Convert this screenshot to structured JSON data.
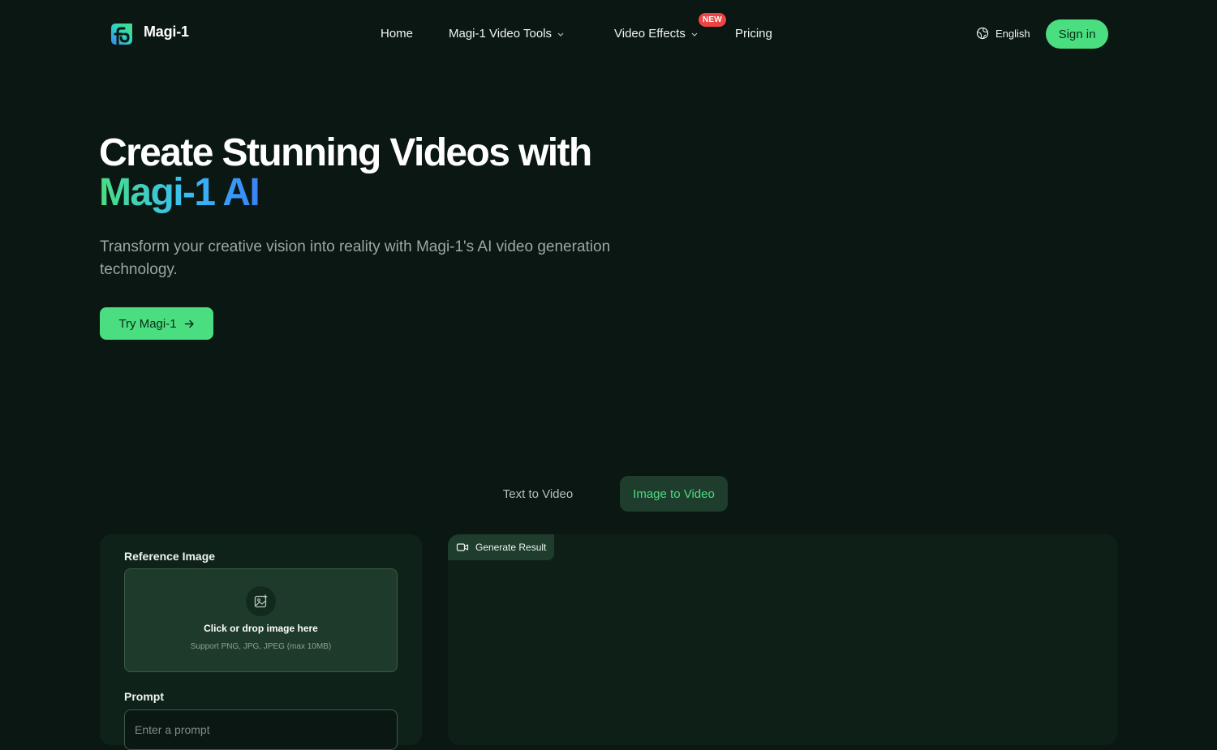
{
  "nav": {
    "brand": "Magi-1",
    "links": {
      "home": "Home",
      "video_tools": "Magi-1 Video Tools",
      "video_effects": "Video Effects",
      "pricing": "Pricing"
    },
    "new_badge": "NEW",
    "language": "English",
    "sign_in": "Sign in"
  },
  "hero": {
    "title_line1": "Create Stunning Videos with",
    "title_line2": "Magi-1 AI",
    "subtitle": "Transform your creative vision into reality with Magi-1's AI video generation technology.",
    "cta": "Try Magi-1"
  },
  "tabs": {
    "text_to_video": "Text to Video",
    "image_to_video": "Image to Video",
    "active": "image_to_video"
  },
  "form": {
    "reference_label": "Reference Image",
    "dropzone_title": "Click or drop image here",
    "dropzone_hint": "Support PNG, JPG, JPEG (max 10MB)",
    "prompt_label": "Prompt",
    "prompt_placeholder": "Enter a prompt"
  },
  "result": {
    "label": "Generate Result"
  },
  "colors": {
    "background": "#0a1712",
    "accent": "#4ade80",
    "badge": "#ef4444",
    "panel": "#0f2219"
  },
  "icons": [
    "logo-mark-icon",
    "chevron-down-icon",
    "globe-icon",
    "arrow-right-icon",
    "image-plus-icon",
    "video-camera-icon"
  ]
}
